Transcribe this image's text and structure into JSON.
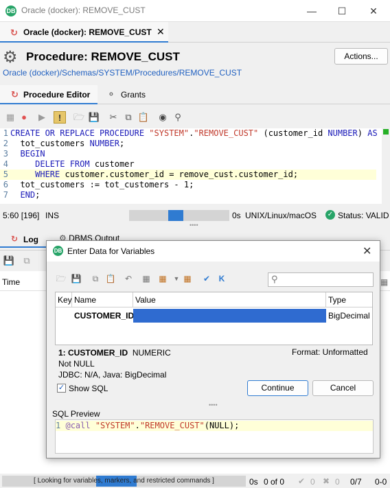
{
  "window": {
    "title": "Oracle (docker): REMOVE_CUST",
    "app_icon": "dbeaver-icon",
    "controls": [
      "minimize",
      "maximize",
      "close"
    ]
  },
  "editor_tab": {
    "label": "Oracle (docker): REMOVE_CUST",
    "close": "✕"
  },
  "header": {
    "title": "Procedure: REMOVE_CUST",
    "actions_label": "Actions...",
    "breadcrumb": "Oracle (docker)/Schemas/SYSTEM/Procedures/REMOVE_CUST"
  },
  "subtabs": {
    "procedure_editor": "Procedure Editor",
    "grants": "Grants"
  },
  "code": {
    "lines": [
      {
        "n": "1",
        "parts": [
          [
            "kw",
            "CREATE OR REPLACE PROCEDURE "
          ],
          [
            "str",
            "\"SYSTEM\""
          ],
          [
            "",
            "."
          ],
          [
            "str",
            "\"REMOVE_CUST\""
          ],
          [
            "",
            " (customer_id "
          ],
          [
            "kw",
            "NUMBER"
          ],
          [
            "",
            ") "
          ],
          [
            "kw",
            "AS"
          ]
        ]
      },
      {
        "n": "2",
        "parts": [
          [
            "",
            "  tot_customers "
          ],
          [
            "kw",
            "NUMBER"
          ],
          [
            "",
            ";"
          ]
        ]
      },
      {
        "n": "3",
        "parts": [
          [
            "kw",
            "  BEGIN"
          ]
        ]
      },
      {
        "n": "4",
        "parts": [
          [
            "kw",
            "     DELETE FROM "
          ],
          [
            "",
            "customer"
          ]
        ]
      },
      {
        "n": "5",
        "parts": [
          [
            "kw",
            "     WHERE "
          ],
          [
            "",
            "customer.customer_id = remove_cust.customer_id;"
          ]
        ],
        "highlight": true
      },
      {
        "n": "6",
        "parts": [
          [
            "",
            "  tot_customers := tot_customers - 1;"
          ]
        ]
      },
      {
        "n": "7",
        "parts": [
          [
            "kw",
            "  END"
          ],
          [
            "",
            ";"
          ]
        ]
      }
    ]
  },
  "status": {
    "cursor": "5:60 [196]",
    "mode": "INS",
    "timer": "0s",
    "os": "UNIX/Linux/macOS",
    "validity": "Status: VALID"
  },
  "bottom": {
    "log_tab": "Log",
    "dbms_tab": "DBMS Output",
    "time_col": "Time",
    "looking": "[ Looking for variables, markers, and restricted commands ]",
    "timer": "0s",
    "of": "0 of 0",
    "warn_count": "0",
    "err_count": "0",
    "ratio": "0/7",
    "zero": "0-0"
  },
  "dialog": {
    "title": "Enter Data for Variables",
    "columns": [
      "Key",
      "Name",
      "Value",
      "Type"
    ],
    "row": {
      "key": "",
      "name": "CUSTOMER_ID",
      "value": "",
      "type": "BigDecimal"
    },
    "info_name": "1: CUSTOMER_ID",
    "info_type": "NUMERIC",
    "info_null": "Not NULL",
    "info_jdbc": "JDBC: N/A, Java: BigDecimal",
    "format": "Format: Unformatted",
    "show_sql": "Show SQL",
    "show_sql_checked": true,
    "continue": "Continue",
    "cancel": "Cancel",
    "sql_preview_label": "SQL Preview",
    "sql_line_no": "1",
    "sql_call": "@call ",
    "sql_schema": "\"SYSTEM\"",
    "sql_dot": ".",
    "sql_proc": "\"REMOVE_CUST\"",
    "sql_args": "(NULL);"
  },
  "colors": {
    "accent": "#2f7bd1",
    "valid_green": "#27a468",
    "string_red": "#c0392b",
    "keyword_blue": "#1a1ab8",
    "line_highlight": "#ffffd8"
  }
}
